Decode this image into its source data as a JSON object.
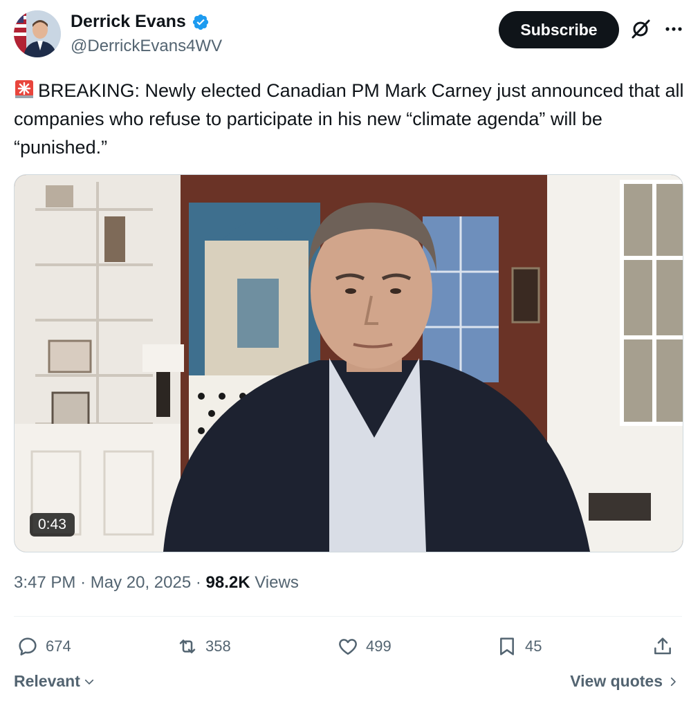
{
  "author": {
    "name": "Derrick Evans",
    "handle": "@DerrickEvans4WV",
    "verified": true
  },
  "header": {
    "subscribe_label": "Subscribe",
    "grok_icon": "grok-icon",
    "more_icon": "more-icon"
  },
  "tweet": {
    "emoji": "siren-icon",
    "text": "BREAKING: Newly elected Canadian PM Mark Carney just announced that all companies who refuse to participate in his new “climate agenda” will be “punished.”"
  },
  "media": {
    "type": "video",
    "duration": "0:43"
  },
  "meta": {
    "time": "3:47 PM",
    "date": "May 20, 2025",
    "views_count": "98.2K",
    "views_label": "Views"
  },
  "actions": {
    "replies": "674",
    "reposts": "358",
    "likes": "499",
    "bookmarks": "45"
  },
  "footer": {
    "relevant_label": "Relevant",
    "view_quotes_label": "View quotes"
  },
  "colors": {
    "verified_blue": "#1d9bf0",
    "text_primary": "#0f1419",
    "text_secondary": "#536471",
    "button_dark": "#0f1419"
  }
}
